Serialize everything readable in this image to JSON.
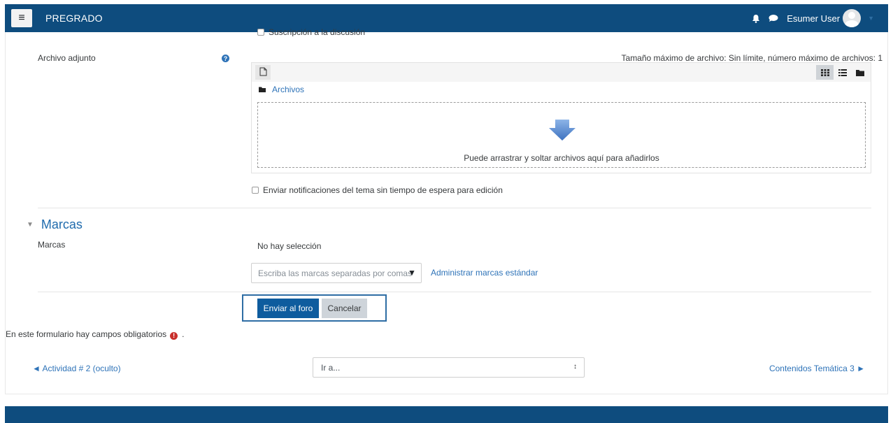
{
  "navbar": {
    "menu_icon": "hamburger-icon",
    "brand": "PREGRADO",
    "notification_icon": "bell-icon",
    "messages_icon": "chat-bubble-icon",
    "user_name": "Esumer User"
  },
  "form": {
    "cut_off_checkbox_label": "Suscripción a la discusión",
    "attachment": {
      "label": "Archivo adjunto",
      "limits": "Tamaño máximo de archivo: Sin límite, número máximo de archivos: 1",
      "folder_link": "Archivos",
      "drop_text": "Puede arrastrar y soltar archivos aquí para añadirlos"
    },
    "notify_checkbox_label": "Enviar notificaciones del tema sin tiempo de espera para edición",
    "tags_section": {
      "title": "Marcas",
      "label": "Marcas",
      "no_selection": "No hay selección",
      "input_placeholder": "Escriba las marcas separadas por comas",
      "manage_link": "Administrar marcas estándar"
    },
    "submit_label": "Enviar al foro",
    "cancel_label": "Cancelar",
    "required_note": "En este formulario hay campos obligatorios",
    "required_note_suffix": "."
  },
  "activity_nav": {
    "prev_link": "◄ Actividad # 2 (oculto)",
    "jump_placeholder": "Ir a...",
    "next_link": "Contenidos Temática 3 ►"
  },
  "colors": {
    "navbar": "#0e4c7e",
    "link": "#2e73b8",
    "primary_button": "#0e5c9e",
    "required": "#c9302c"
  }
}
